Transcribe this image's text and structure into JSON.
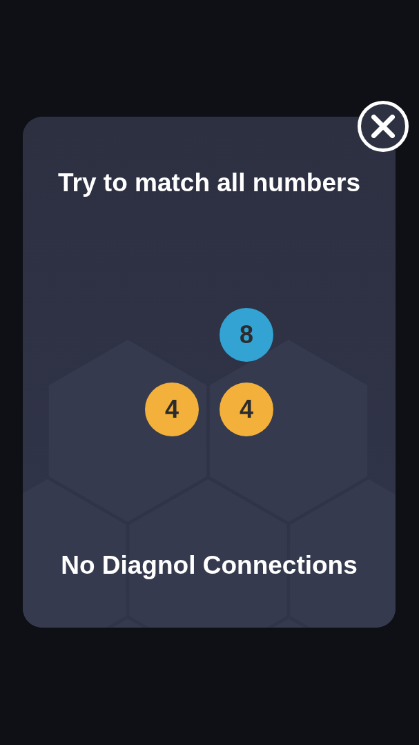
{
  "dialog": {
    "title": "Try to match all numbers",
    "tiles": [
      {
        "value": "8",
        "color": "#33a3d4"
      },
      {
        "value": "4",
        "color": "#f3b13b"
      },
      {
        "value": "4",
        "color": "#f3b13b"
      }
    ],
    "hint": "No Diagnol Connections"
  }
}
